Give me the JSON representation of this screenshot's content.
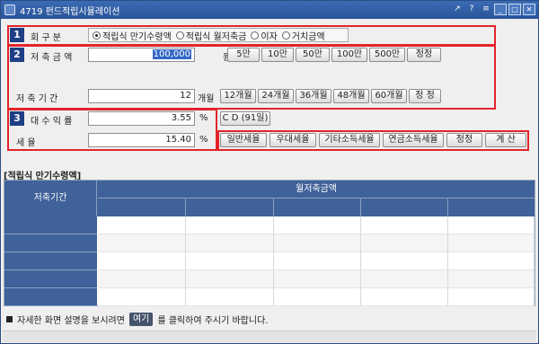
{
  "window": {
    "title": "4719 펀드적립시뮬레이션"
  },
  "titlebar_icons": [
    "pin-icon",
    "help-icon",
    "menu-icon",
    "minimize-icon",
    "maximize-icon",
    "close-icon"
  ],
  "titlebar_glyphs": {
    "pin": "↗",
    "help": "?",
    "menu": "≡",
    "minimize": "_",
    "maximize": "□",
    "close": "✕"
  },
  "section1": {
    "badge": "1",
    "label": "회   구   분",
    "radios": [
      {
        "label": "적립식 만기수령액",
        "checked": true
      },
      {
        "label": "적립식 월저축금",
        "checked": false
      },
      {
        "label": "이자",
        "checked": false
      },
      {
        "label": "거치금액",
        "checked": false
      }
    ]
  },
  "section2": {
    "badge": "2",
    "amount_label": "저  축  금  액",
    "amount_value": "100,000",
    "amount_unit": "원",
    "amount_buttons": [
      "5만",
      "10만",
      "50만",
      "100만",
      "500만",
      "정정"
    ],
    "period_label": "저   축   기   간",
    "period_value": "12",
    "period_unit": "개월",
    "period_buttons": [
      "12개월",
      "24개월",
      "36개월",
      "48개월",
      "60개월",
      "정 정"
    ]
  },
  "section3": {
    "badge": "3",
    "rate_label": "대  수  익  률",
    "rate_value": "3.55",
    "rate_unit": "%",
    "rate_button": "C D (91일)",
    "tax_label": "세              율",
    "tax_value": "15.40",
    "tax_unit": "%",
    "tax_buttons": [
      "일반세율",
      "우대세율",
      "기타소득세율",
      "연금소득세율",
      "정정"
    ],
    "calc_button": "계 산"
  },
  "result": {
    "section_title": "[적립식 만기수령액]",
    "col_period": "저축기간",
    "col_monthly": "월저축금액"
  },
  "footer": {
    "text_before": "자세한 화면 설명을 보시려면",
    "link": "여기",
    "text_after": "를 클릭하여 주시기 바랍니다."
  },
  "colors": {
    "accent": "#1e3f86",
    "highlight_border": "#e3242b",
    "grid_header": "#40629a"
  }
}
